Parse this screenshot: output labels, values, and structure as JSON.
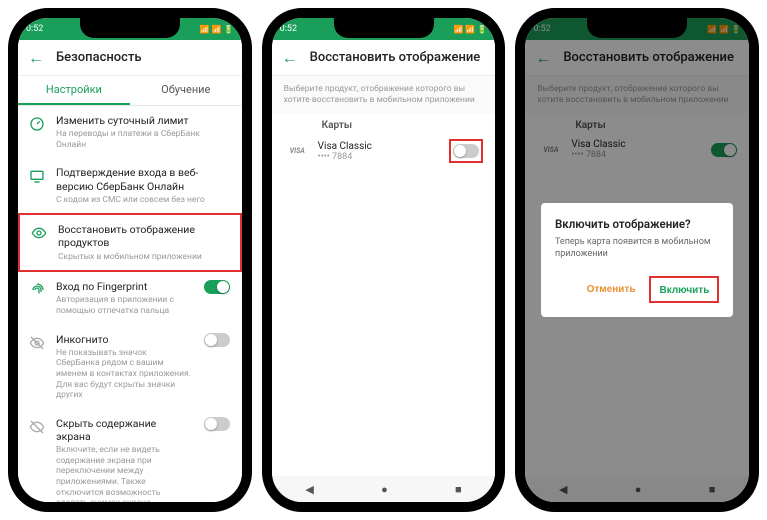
{
  "status": {
    "time": "0:52",
    "icons": "📶 📶 🔋"
  },
  "phone1": {
    "title": "Безопасность",
    "tab_settings": "Настройки",
    "tab_learn": "Обучение",
    "rows": [
      {
        "title": "Изменить суточный лимит",
        "sub": "На переводы и платежи в СберБанк Онлайн"
      },
      {
        "title": "Подтверждение входа в веб-версию СберБанк Онлайн",
        "sub": "С кодом из СМС или совсем без него"
      },
      {
        "title": "Восстановить отображение продуктов",
        "sub": "Скрытых в мобильном приложении"
      },
      {
        "title": "Вход по Fingerprint",
        "sub": "Авторизация в приложении с помощью отпечатка пальца"
      },
      {
        "title": "Инкогнито",
        "sub": "Не показывать значок СберБанка рядом с вашим именем в контактах приложения. Для вас будут скрыты значки других"
      },
      {
        "title": "Скрыть содержание экрана",
        "sub": "Включите, если не видеть содержание экрана при переключении между приложениями. Также отключится возможность сделать снимок экрана"
      }
    ]
  },
  "phone2": {
    "title": "Восстановить отображение",
    "instruction": "Выберите продукт, отображение которого вы хотите восстановить в мобильном приложении",
    "section": "Карты",
    "card_brand": "VISA",
    "card_name": "Visa Classic",
    "card_num": "•••• 7884"
  },
  "phone3": {
    "title": "Восстановить отображение",
    "instruction": "Выберите продукт, отображение которого вы хотите восстановить в мобильном приложении",
    "section": "Карты",
    "card_brand": "VISA",
    "card_name": "Visa Classic",
    "card_num": "•••• 7884",
    "dialog": {
      "title": "Включить отображение?",
      "msg": "Теперь карта появится в мобильном приложении",
      "cancel": "Отменить",
      "confirm": "Включить"
    }
  }
}
